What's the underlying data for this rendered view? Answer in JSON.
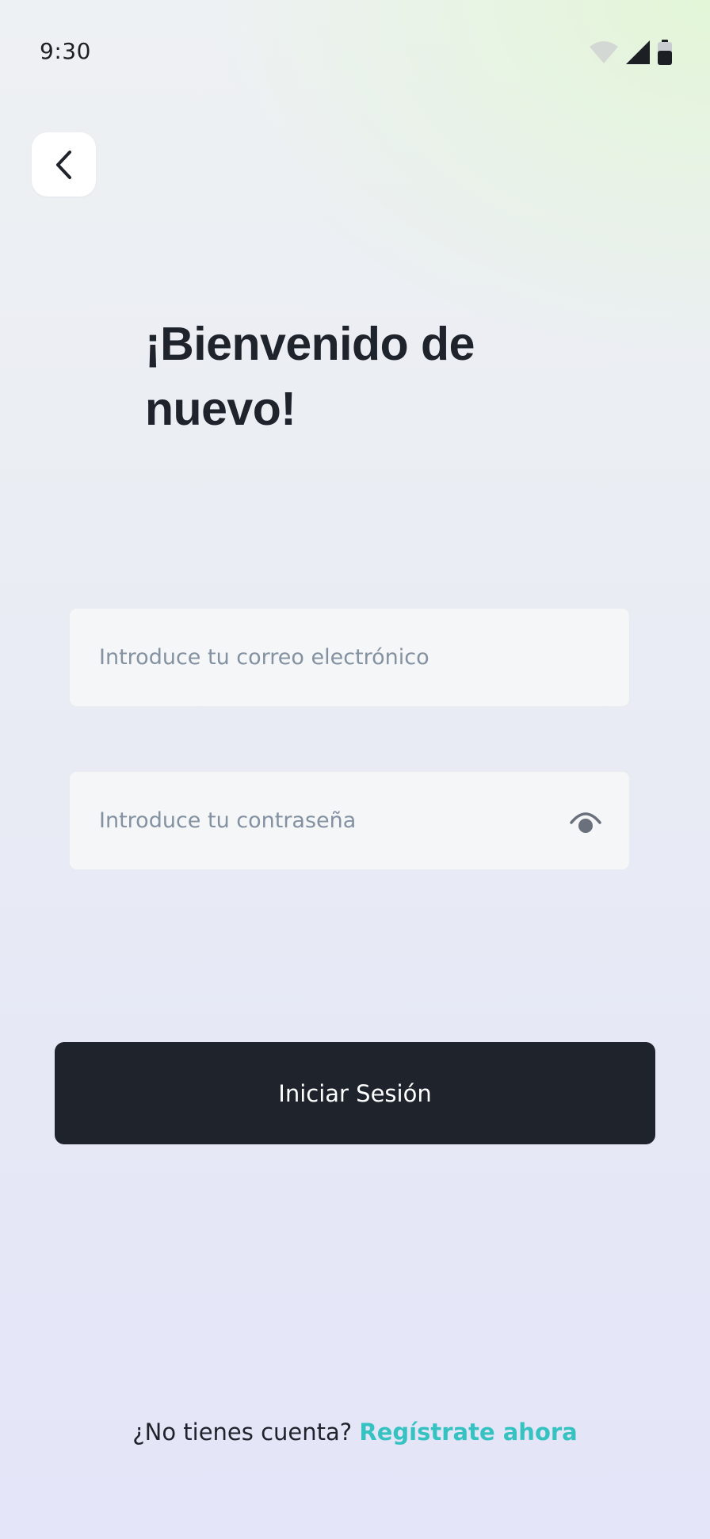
{
  "status_bar": {
    "time": "9:30",
    "icons": [
      "wifi-icon",
      "signal-icon",
      "battery-icon"
    ]
  },
  "header": {
    "back_icon": "chevron-left-icon"
  },
  "main": {
    "title": "¡Bienvenido de nuevo!",
    "email_placeholder": "Introduce tu correo electrónico",
    "password_placeholder": "Introduce tu contraseña",
    "password_toggle_icon": "eye-icon",
    "login_label": "Iniciar Sesión"
  },
  "footer": {
    "prompt": "¿No tienes cuenta?",
    "register_label": "Regístrate ahora"
  },
  "colors": {
    "primary": "#1E232C",
    "accent": "#35C2C1",
    "placeholder": "#8391A1",
    "field_background": "#F5F6F8"
  }
}
